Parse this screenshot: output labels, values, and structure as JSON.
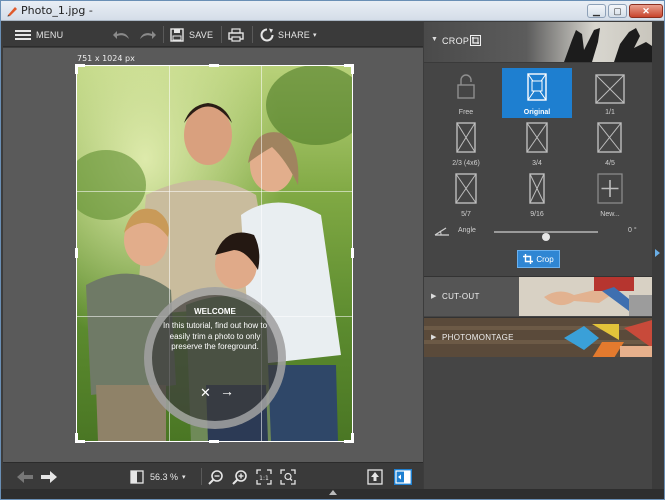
{
  "window": {
    "title": "Photo_1.jpg -",
    "minimize": "▁",
    "maximize": "▢",
    "close": "✕"
  },
  "toolbar": {
    "menu_label": "MENU",
    "save_label": "SAVE",
    "share_label": "SHARE"
  },
  "canvas": {
    "dimensions": "751 x 1024 px"
  },
  "welcome": {
    "title": "WELCOME",
    "body": "In this tutorial, find out how to easily trim a photo to only preserve the foreground.",
    "close_icon": "close-icon",
    "next_icon": "arrow-right-icon"
  },
  "bottombar": {
    "zoom_value": "56.3 %"
  },
  "panel": {
    "crop": {
      "header": "CROP",
      "ratios": [
        {
          "label": "Free",
          "icon": "lock-icon"
        },
        {
          "label": "Original",
          "icon": "image-icon"
        },
        {
          "label": "1/1",
          "icon": "ratio-icon"
        },
        {
          "label": "2/3 (4x6)",
          "icon": "ratio-icon"
        },
        {
          "label": "3/4",
          "icon": "ratio-icon"
        },
        {
          "label": "4/5",
          "icon": "ratio-icon"
        },
        {
          "label": "5/7",
          "icon": "ratio-icon"
        },
        {
          "label": "9/16",
          "icon": "ratio-icon"
        },
        {
          "label": "New...",
          "icon": "plus-icon"
        }
      ],
      "selected_ratio": "Original",
      "angle_label": "Angle",
      "angle_value": "0 °",
      "angle_level": 0.5,
      "crop_button": "Crop"
    },
    "cutout": {
      "header": "CUT-OUT"
    },
    "photomontage": {
      "header": "PHOTOMONTAGE"
    }
  },
  "colors": {
    "accent": "#1e7fd0",
    "panel_bg": "#454545",
    "canvas_bg": "#5a5a5a",
    "toolbar_bg": "#3a3a3a"
  }
}
